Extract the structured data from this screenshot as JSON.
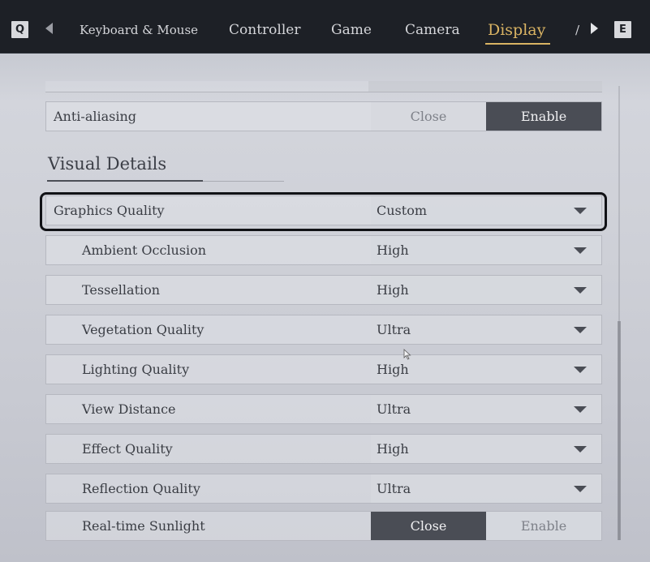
{
  "topbar": {
    "left_key": "Q",
    "right_key": "E",
    "tabs": [
      {
        "label": "Keyboard & Mouse"
      },
      {
        "label": "Controller"
      },
      {
        "label": "Game"
      },
      {
        "label": "Camera"
      },
      {
        "label": "Display"
      },
      {
        "label": "/"
      }
    ],
    "active_tab": "Display",
    "accent_color": "#d9b363"
  },
  "settings": {
    "anti_aliasing": {
      "label": "Anti-aliasing",
      "off": "Close",
      "on": "Enable",
      "selected": "Enable"
    },
    "section_title": "Visual Details",
    "graphics_quality": {
      "label": "Graphics Quality",
      "value": "Custom"
    },
    "items": [
      {
        "label": "Ambient Occlusion",
        "value": "High"
      },
      {
        "label": "Tessellation",
        "value": "High"
      },
      {
        "label": "Vegetation Quality",
        "value": "Ultra"
      },
      {
        "label": "Lighting Quality",
        "value": "High"
      },
      {
        "label": "View Distance",
        "value": "Ultra"
      },
      {
        "label": "Effect Quality",
        "value": "High"
      },
      {
        "label": "Reflection Quality",
        "value": "Ultra"
      }
    ],
    "realtime_sunlight": {
      "label": "Real-time Sunlight",
      "off": "Close",
      "on": "Enable",
      "selected": "Close"
    }
  }
}
